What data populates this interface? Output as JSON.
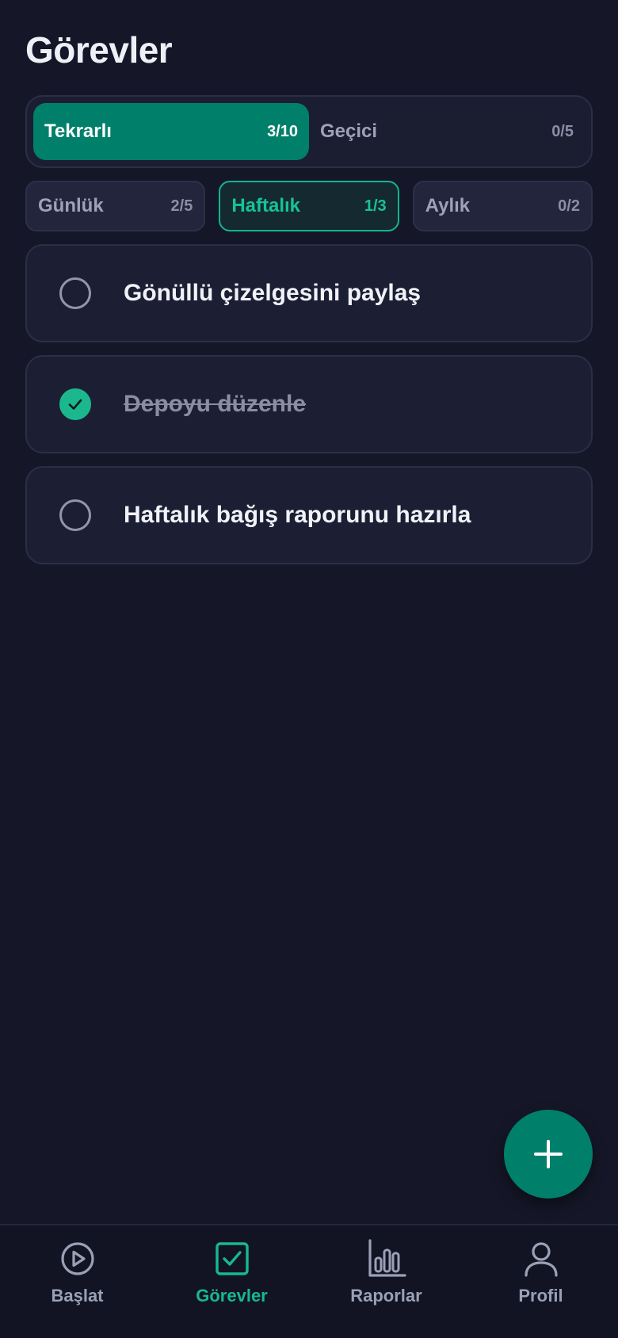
{
  "header": {
    "title": "Görevler"
  },
  "segment": {
    "items": [
      {
        "label": "Tekrarlı",
        "count": "3/10"
      },
      {
        "label": "Geçici",
        "count": "0/5"
      }
    ]
  },
  "periods": {
    "items": [
      {
        "label": "Günlük",
        "count": "2/5"
      },
      {
        "label": "Haftalık",
        "count": "1/3"
      },
      {
        "label": "Aylık",
        "count": "0/2"
      }
    ]
  },
  "tasks": [
    {
      "text": "Gönüllü çizelgesini paylaş",
      "done": false
    },
    {
      "text": "Depoyu düzenle",
      "done": true
    },
    {
      "text": "Haftalık bağış raporunu hazırla",
      "done": false
    }
  ],
  "fab": {
    "icon": "plus-icon"
  },
  "nav": {
    "items": [
      {
        "label": "Başlat",
        "icon": "play-circle-icon"
      },
      {
        "label": "Görevler",
        "icon": "checkbox-icon"
      },
      {
        "label": "Raporlar",
        "icon": "bar-chart-icon"
      },
      {
        "label": "Profil",
        "icon": "user-icon"
      }
    ]
  },
  "colors": {
    "background": "#151728",
    "accent": "#00806a",
    "accent_text": "#17c29a",
    "card": "#1c1e33"
  }
}
